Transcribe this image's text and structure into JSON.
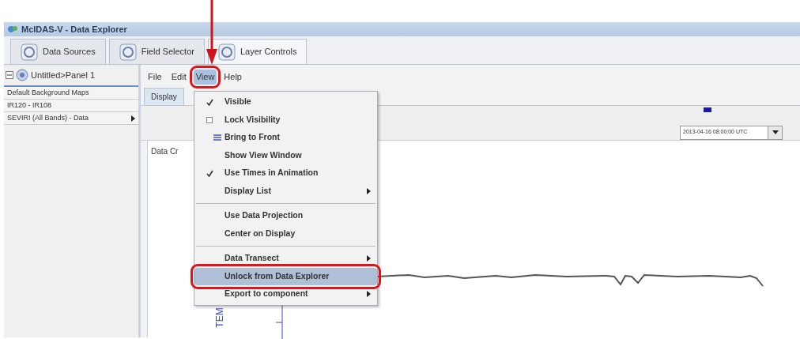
{
  "window": {
    "title": "McIDAS-V - Data Explorer"
  },
  "tabs": [
    {
      "label": "Data Sources",
      "selected": false
    },
    {
      "label": "Field Selector",
      "selected": false
    },
    {
      "label": "Layer Controls",
      "selected": true
    }
  ],
  "sidebar": {
    "title": "Untitled>Panel 1",
    "items": [
      {
        "label": "Default Background Maps",
        "submenu": false
      },
      {
        "label": "IR120 - IR108",
        "submenu": false
      },
      {
        "label": "SEVIRI (All Bands) - Data",
        "submenu": true
      }
    ]
  },
  "menubar": [
    {
      "label": "File",
      "selected": false
    },
    {
      "label": "Edit",
      "selected": false
    },
    {
      "label": "View",
      "selected": true,
      "highlighted": true
    },
    {
      "label": "Help",
      "selected": false
    }
  ],
  "display_tab": {
    "label": "Display"
  },
  "section_label": "Data Cr",
  "time_field": {
    "value": "2013-04-16 08:00:00 UTC"
  },
  "axis_label": "TEM",
  "view_menu": [
    {
      "kind": "check",
      "label": "Visible",
      "checked": true,
      "selected": false
    },
    {
      "kind": "check",
      "label": "Lock Visibility",
      "checked": false,
      "selected": false
    },
    {
      "kind": "icon",
      "label": "Bring to Front",
      "selected": false
    },
    {
      "kind": "plain",
      "label": "Show View Window",
      "selected": false
    },
    {
      "kind": "check",
      "label": "Use Times in Animation",
      "checked": true,
      "selected": false
    },
    {
      "kind": "submenu",
      "label": "Display List",
      "selected": false
    },
    {
      "kind": "separator"
    },
    {
      "kind": "plain",
      "label": "Use Data Projection",
      "selected": false
    },
    {
      "kind": "plain",
      "label": "Center on Display",
      "selected": false
    },
    {
      "kind": "separator"
    },
    {
      "kind": "submenu",
      "label": "Data Transect",
      "selected": false
    },
    {
      "kind": "plain",
      "label": "Unlock from Data Explorer",
      "selected": true,
      "highlighted": true
    },
    {
      "kind": "submenu",
      "label": "Export to component",
      "selected": false
    }
  ]
}
